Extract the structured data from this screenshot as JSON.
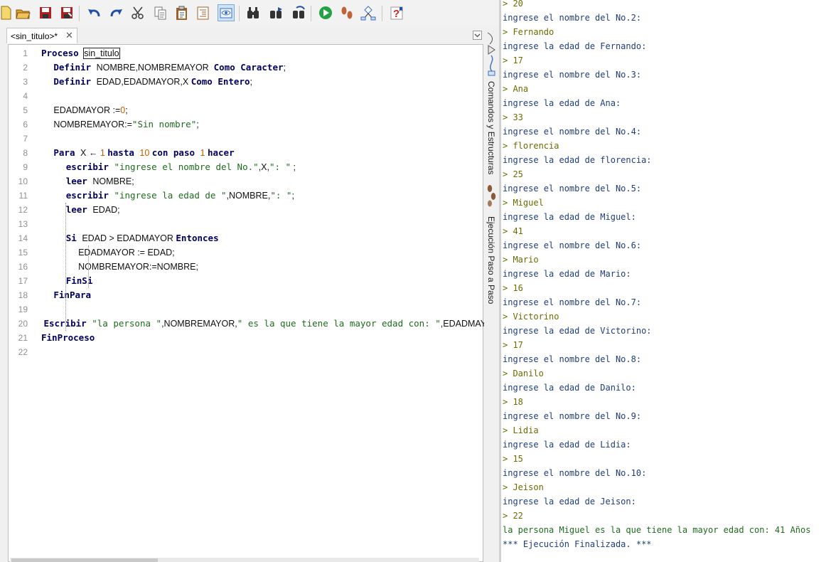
{
  "editor": {
    "tab_label": "<sin_titulo>*",
    "tab_close": "✕",
    "lines": [
      {
        "n": "1",
        "segs": [
          {
            "t": "Proceso ",
            "c": "kw"
          },
          {
            "t": "sin_titulo",
            "c": "box"
          }
        ]
      },
      {
        "n": "2",
        "segs": [
          {
            "t": "     "
          },
          {
            "t": "Definir ",
            "c": "kw"
          },
          {
            "t": "NOMBRE,NOMBREMAYOR  "
          },
          {
            "t": "Como Caracter",
            "c": "kw"
          },
          {
            "t": ";"
          }
        ]
      },
      {
        "n": "3",
        "segs": [
          {
            "t": "     "
          },
          {
            "t": "Definir ",
            "c": "kw"
          },
          {
            "t": "EDAD,EDADMAYOR,X "
          },
          {
            "t": "Como Entero",
            "c": "kw"
          },
          {
            "t": ";"
          }
        ]
      },
      {
        "n": "4",
        "segs": []
      },
      {
        "n": "5",
        "segs": [
          {
            "t": "     EDADMAYOR :="
          },
          {
            "t": "0",
            "c": "nm"
          },
          {
            "t": ";"
          }
        ]
      },
      {
        "n": "6",
        "segs": [
          {
            "t": "     NOMBREMAYOR:="
          },
          {
            "t": "\"Sin nombre\"",
            "c": "st"
          },
          {
            "t": ";"
          }
        ]
      },
      {
        "n": "7",
        "segs": []
      },
      {
        "n": "8",
        "segs": [
          {
            "t": "     "
          },
          {
            "t": "Para ",
            "c": "kw"
          },
          {
            "t": "X ← "
          },
          {
            "t": "1",
            "c": "nm"
          },
          {
            "t": " "
          },
          {
            "t": "hasta ",
            "c": "kw"
          },
          {
            "t": "10",
            "c": "nm"
          },
          {
            "t": " "
          },
          {
            "t": "con paso ",
            "c": "kw"
          },
          {
            "t": "1",
            "c": "nm"
          },
          {
            "t": " "
          },
          {
            "t": "hacer",
            "c": "kw"
          }
        ]
      },
      {
        "n": "9",
        "segs": [
          {
            "t": "          "
          },
          {
            "t": "escribir ",
            "c": "kw"
          },
          {
            "t": "\"ingrese el nombre del No.\"",
            "c": "st"
          },
          {
            "t": ",X,"
          },
          {
            "t": "\": \"",
            "c": "st"
          },
          {
            "t": " ;"
          }
        ]
      },
      {
        "n": "10",
        "segs": [
          {
            "t": "          "
          },
          {
            "t": "leer ",
            "c": "kw"
          },
          {
            "t": "NOMBRE;"
          }
        ]
      },
      {
        "n": "11",
        "segs": [
          {
            "t": "          "
          },
          {
            "t": "escribir ",
            "c": "kw"
          },
          {
            "t": "\"ingrese la edad de \"",
            "c": "st"
          },
          {
            "t": ",NOMBRE,"
          },
          {
            "t": "\": \"",
            "c": "st"
          },
          {
            "t": ";"
          }
        ]
      },
      {
        "n": "12",
        "segs": [
          {
            "t": "          "
          },
          {
            "t": "leer ",
            "c": "kw"
          },
          {
            "t": "EDAD;"
          }
        ]
      },
      {
        "n": "13",
        "segs": []
      },
      {
        "n": "14",
        "segs": [
          {
            "t": "          "
          },
          {
            "t": "Si ",
            "c": "kw"
          },
          {
            "t": "EDAD > EDADMAYOR "
          },
          {
            "t": "Entonces",
            "c": "kw"
          }
        ]
      },
      {
        "n": "15",
        "segs": [
          {
            "t": "               EDADMAYOR := EDAD;"
          }
        ]
      },
      {
        "n": "16",
        "segs": [
          {
            "t": "               NOMBREMAYOR:=NOMBRE;"
          }
        ]
      },
      {
        "n": "17",
        "segs": [
          {
            "t": "          "
          },
          {
            "t": "FinSi",
            "c": "kw"
          }
        ]
      },
      {
        "n": "18",
        "segs": [
          {
            "t": "     "
          },
          {
            "t": "FinPara",
            "c": "kw"
          }
        ]
      },
      {
        "n": "19",
        "segs": []
      },
      {
        "n": "20",
        "segs": [
          {
            "t": " "
          },
          {
            "t": "Escribir ",
            "c": "kw"
          },
          {
            "t": "\"la persona \"",
            "c": "st"
          },
          {
            "t": ",NOMBREMAYOR,"
          },
          {
            "t": "\" es la que tiene la mayor edad con: \"",
            "c": "st"
          },
          {
            "t": ",EDADMAYOR,"
          },
          {
            "t": "\"",
            "c": "st"
          }
        ]
      },
      {
        "n": "21",
        "segs": [
          {
            "t": "FinProceso",
            "c": "kw"
          }
        ]
      },
      {
        "n": "22",
        "segs": []
      }
    ]
  },
  "side_tabs": {
    "commands": "Comandos y Estructuras",
    "step": "Ejecución Paso a Paso"
  },
  "console": {
    "lines": [
      {
        "t": "> 20",
        "k": "input"
      },
      {
        "t": "ingrese el nombre del No.2:",
        "k": "prompt"
      },
      {
        "t": "> Fernando",
        "k": "input"
      },
      {
        "t": "ingrese la edad de Fernando:",
        "k": "prompt"
      },
      {
        "t": "> 17",
        "k": "input"
      },
      {
        "t": "ingrese el nombre del No.3:",
        "k": "prompt"
      },
      {
        "t": "> Ana",
        "k": "input"
      },
      {
        "t": "ingrese la edad de Ana:",
        "k": "prompt"
      },
      {
        "t": "> 33",
        "k": "input"
      },
      {
        "t": "ingrese el nombre del No.4:",
        "k": "prompt"
      },
      {
        "t": "> florencia",
        "k": "input"
      },
      {
        "t": "ingrese la edad de florencia:",
        "k": "prompt"
      },
      {
        "t": "> 25",
        "k": "input"
      },
      {
        "t": "ingrese el nombre del No.5:",
        "k": "prompt"
      },
      {
        "t": "> Miguel",
        "k": "input"
      },
      {
        "t": "ingrese la edad de Miguel:",
        "k": "prompt"
      },
      {
        "t": "> 41",
        "k": "input"
      },
      {
        "t": "ingrese el nombre del No.6:",
        "k": "prompt"
      },
      {
        "t": "> Mario",
        "k": "input"
      },
      {
        "t": "ingrese la edad de Mario:",
        "k": "prompt"
      },
      {
        "t": "> 16",
        "k": "input"
      },
      {
        "t": "ingrese el nombre del No.7:",
        "k": "prompt"
      },
      {
        "t": "> Victorino",
        "k": "input"
      },
      {
        "t": "ingrese la edad de Victorino:",
        "k": "prompt"
      },
      {
        "t": "> 17",
        "k": "input"
      },
      {
        "t": "ingrese el nombre del No.8:",
        "k": "prompt"
      },
      {
        "t": "> Danilo",
        "k": "input"
      },
      {
        "t": "ingrese la edad de Danilo:",
        "k": "prompt"
      },
      {
        "t": "> 18",
        "k": "input"
      },
      {
        "t": "ingrese el nombre del No.9:",
        "k": "prompt"
      },
      {
        "t": "> Lidia",
        "k": "input"
      },
      {
        "t": "ingrese la edad de Lidia:",
        "k": "prompt"
      },
      {
        "t": "> 15",
        "k": "input"
      },
      {
        "t": "ingrese el nombre del No.10:",
        "k": "prompt"
      },
      {
        "t": "> Jeison",
        "k": "input"
      },
      {
        "t": "ingrese la edad de Jeison:",
        "k": "prompt"
      },
      {
        "t": "> 22",
        "k": "input"
      },
      {
        "t": "la persona Miguel es la que tiene la mayor edad con: 41 Años",
        "k": "result"
      },
      {
        "t": "*** Ejecución Finalizada. ***",
        "k": "end"
      }
    ]
  },
  "toolbar": {
    "buttons": [
      {
        "name": "new-file-icon",
        "color": "#f5d76e",
        "active": false
      },
      {
        "name": "open-folder-icon",
        "color": "#e0a030",
        "active": false
      },
      {
        "name": "save-icon",
        "color": "#b02020",
        "active": false
      },
      {
        "name": "save-as-icon",
        "color": "#b02020",
        "active": false
      },
      {
        "name": "undo-icon",
        "color": "#1f4fa8",
        "active": false
      },
      {
        "name": "redo-icon",
        "color": "#1f4fa8",
        "active": false
      },
      {
        "name": "cut-icon",
        "color": "#444444",
        "active": false
      },
      {
        "name": "copy-icon",
        "color": "#777777",
        "active": false
      },
      {
        "name": "paste-icon",
        "color": "#a0622a",
        "active": false
      },
      {
        "name": "indent-icon",
        "color": "#a0622a",
        "active": false
      },
      {
        "name": "preview-icon",
        "color": "#3a6fc4",
        "active": true
      },
      {
        "name": "find-icon",
        "color": "#333333",
        "active": false
      },
      {
        "name": "find-next-icon",
        "color": "#333333",
        "active": false
      },
      {
        "name": "replace-icon",
        "color": "#333333",
        "active": false
      },
      {
        "name": "run-icon",
        "color": "#21a345",
        "active": false
      },
      {
        "name": "step-run-icon",
        "color": "#c0623a",
        "active": false
      },
      {
        "name": "flowchart-icon",
        "color": "#3a6fc4",
        "active": false
      },
      {
        "name": "help-icon",
        "color": "#d42020",
        "active": false
      }
    ]
  }
}
